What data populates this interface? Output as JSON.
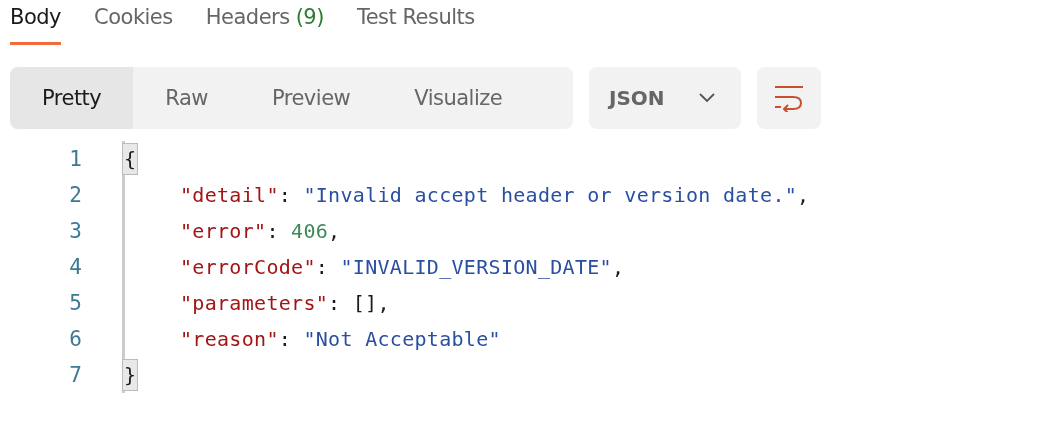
{
  "tabs": [
    {
      "label": "Body",
      "selected": true
    },
    {
      "label": "Cookies",
      "selected": false
    },
    {
      "label": "Headers",
      "count": "(9)",
      "selected": false
    },
    {
      "label": "Test Results",
      "selected": false
    }
  ],
  "view_modes": [
    {
      "label": "Pretty",
      "selected": true
    },
    {
      "label": "Raw",
      "selected": false
    },
    {
      "label": "Preview",
      "selected": false
    },
    {
      "label": "Visualize",
      "selected": false
    }
  ],
  "format": {
    "value": "JSON"
  },
  "code": [
    {
      "number": "1",
      "kind": "brace",
      "tokens": [
        {
          "kind": "punct",
          "text": "{"
        }
      ]
    },
    {
      "number": "2",
      "kind": "member",
      "tokens": [
        {
          "kind": "key",
          "text": "\"detail\""
        },
        {
          "kind": "punct",
          "text": ": "
        },
        {
          "kind": "string",
          "text": "\"Invalid accept header or version date.\""
        },
        {
          "kind": "punct",
          "text": ","
        }
      ]
    },
    {
      "number": "3",
      "kind": "member",
      "tokens": [
        {
          "kind": "key",
          "text": "\"error\""
        },
        {
          "kind": "punct",
          "text": ": "
        },
        {
          "kind": "number",
          "text": "406"
        },
        {
          "kind": "punct",
          "text": ","
        }
      ]
    },
    {
      "number": "4",
      "kind": "member",
      "tokens": [
        {
          "kind": "key",
          "text": "\"errorCode\""
        },
        {
          "kind": "punct",
          "text": ": "
        },
        {
          "kind": "string",
          "text": "\"INVALID_VERSION_DATE\""
        },
        {
          "kind": "punct",
          "text": ","
        }
      ]
    },
    {
      "number": "5",
      "kind": "member",
      "tokens": [
        {
          "kind": "key",
          "text": "\"parameters\""
        },
        {
          "kind": "punct",
          "text": ": [],"
        }
      ]
    },
    {
      "number": "6",
      "kind": "member",
      "tokens": [
        {
          "kind": "key",
          "text": "\"reason\""
        },
        {
          "kind": "punct",
          "text": ": "
        },
        {
          "kind": "string",
          "text": "\"Not Acceptable\""
        }
      ]
    },
    {
      "number": "7",
      "kind": "brace",
      "tokens": [
        {
          "kind": "punct",
          "text": "}"
        }
      ]
    }
  ]
}
